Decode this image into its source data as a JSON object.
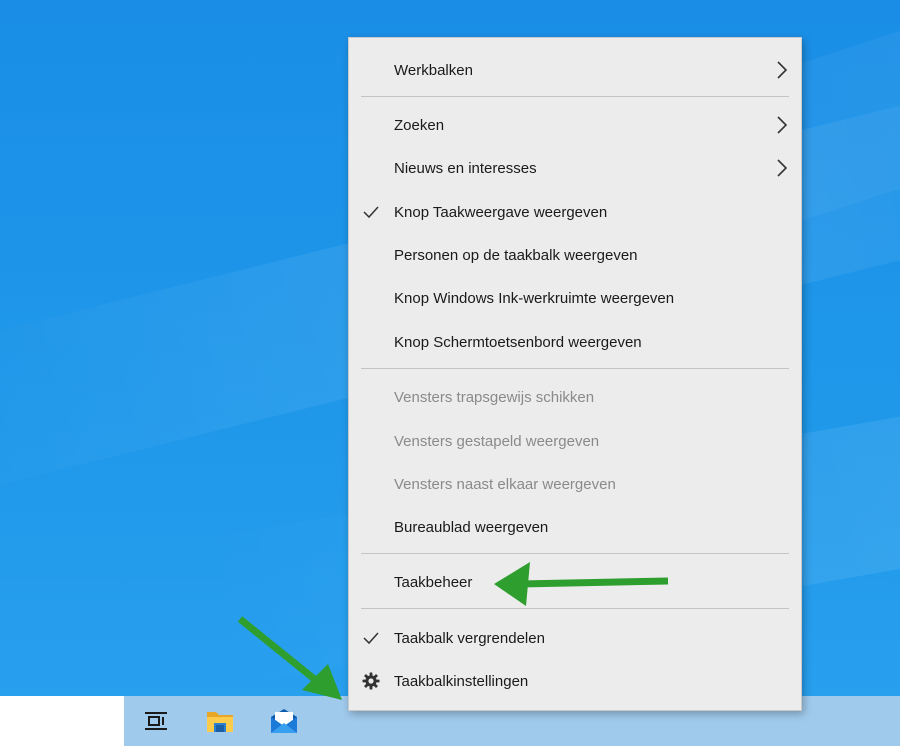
{
  "context_menu": {
    "items": [
      {
        "label": "Werkbalken"
      },
      {
        "label": "Zoeken"
      },
      {
        "label": "Nieuws en interesses"
      },
      {
        "label": "Knop Taakweergave weergeven",
        "checked": true
      },
      {
        "label": "Personen op de taakbalk weergeven"
      },
      {
        "label": "Knop Windows Ink-werkruimte weergeven"
      },
      {
        "label": "Knop Schermtoetsenbord weergeven"
      },
      {
        "label": "Vensters trapsgewijs schikken",
        "disabled": true
      },
      {
        "label": "Vensters gestapeld weergeven",
        "disabled": true
      },
      {
        "label": "Vensters naast elkaar weergeven",
        "disabled": true
      },
      {
        "label": "Bureaublad weergeven"
      },
      {
        "label": "Taakbeheer"
      },
      {
        "label": "Taakbalk vergrendelen",
        "checked": true
      },
      {
        "label": "Taakbalkinstellingen"
      }
    ]
  },
  "taskbar": {
    "icons": [
      "task-view-icon",
      "file-explorer-icon",
      "mail-icon"
    ]
  },
  "annotation": {
    "arrow_color": "#2e9e2e"
  },
  "colors": {
    "desktop_blue": "#1f98ea",
    "menu_background": "#ececec",
    "disabled_text": "#8a8a8a"
  }
}
